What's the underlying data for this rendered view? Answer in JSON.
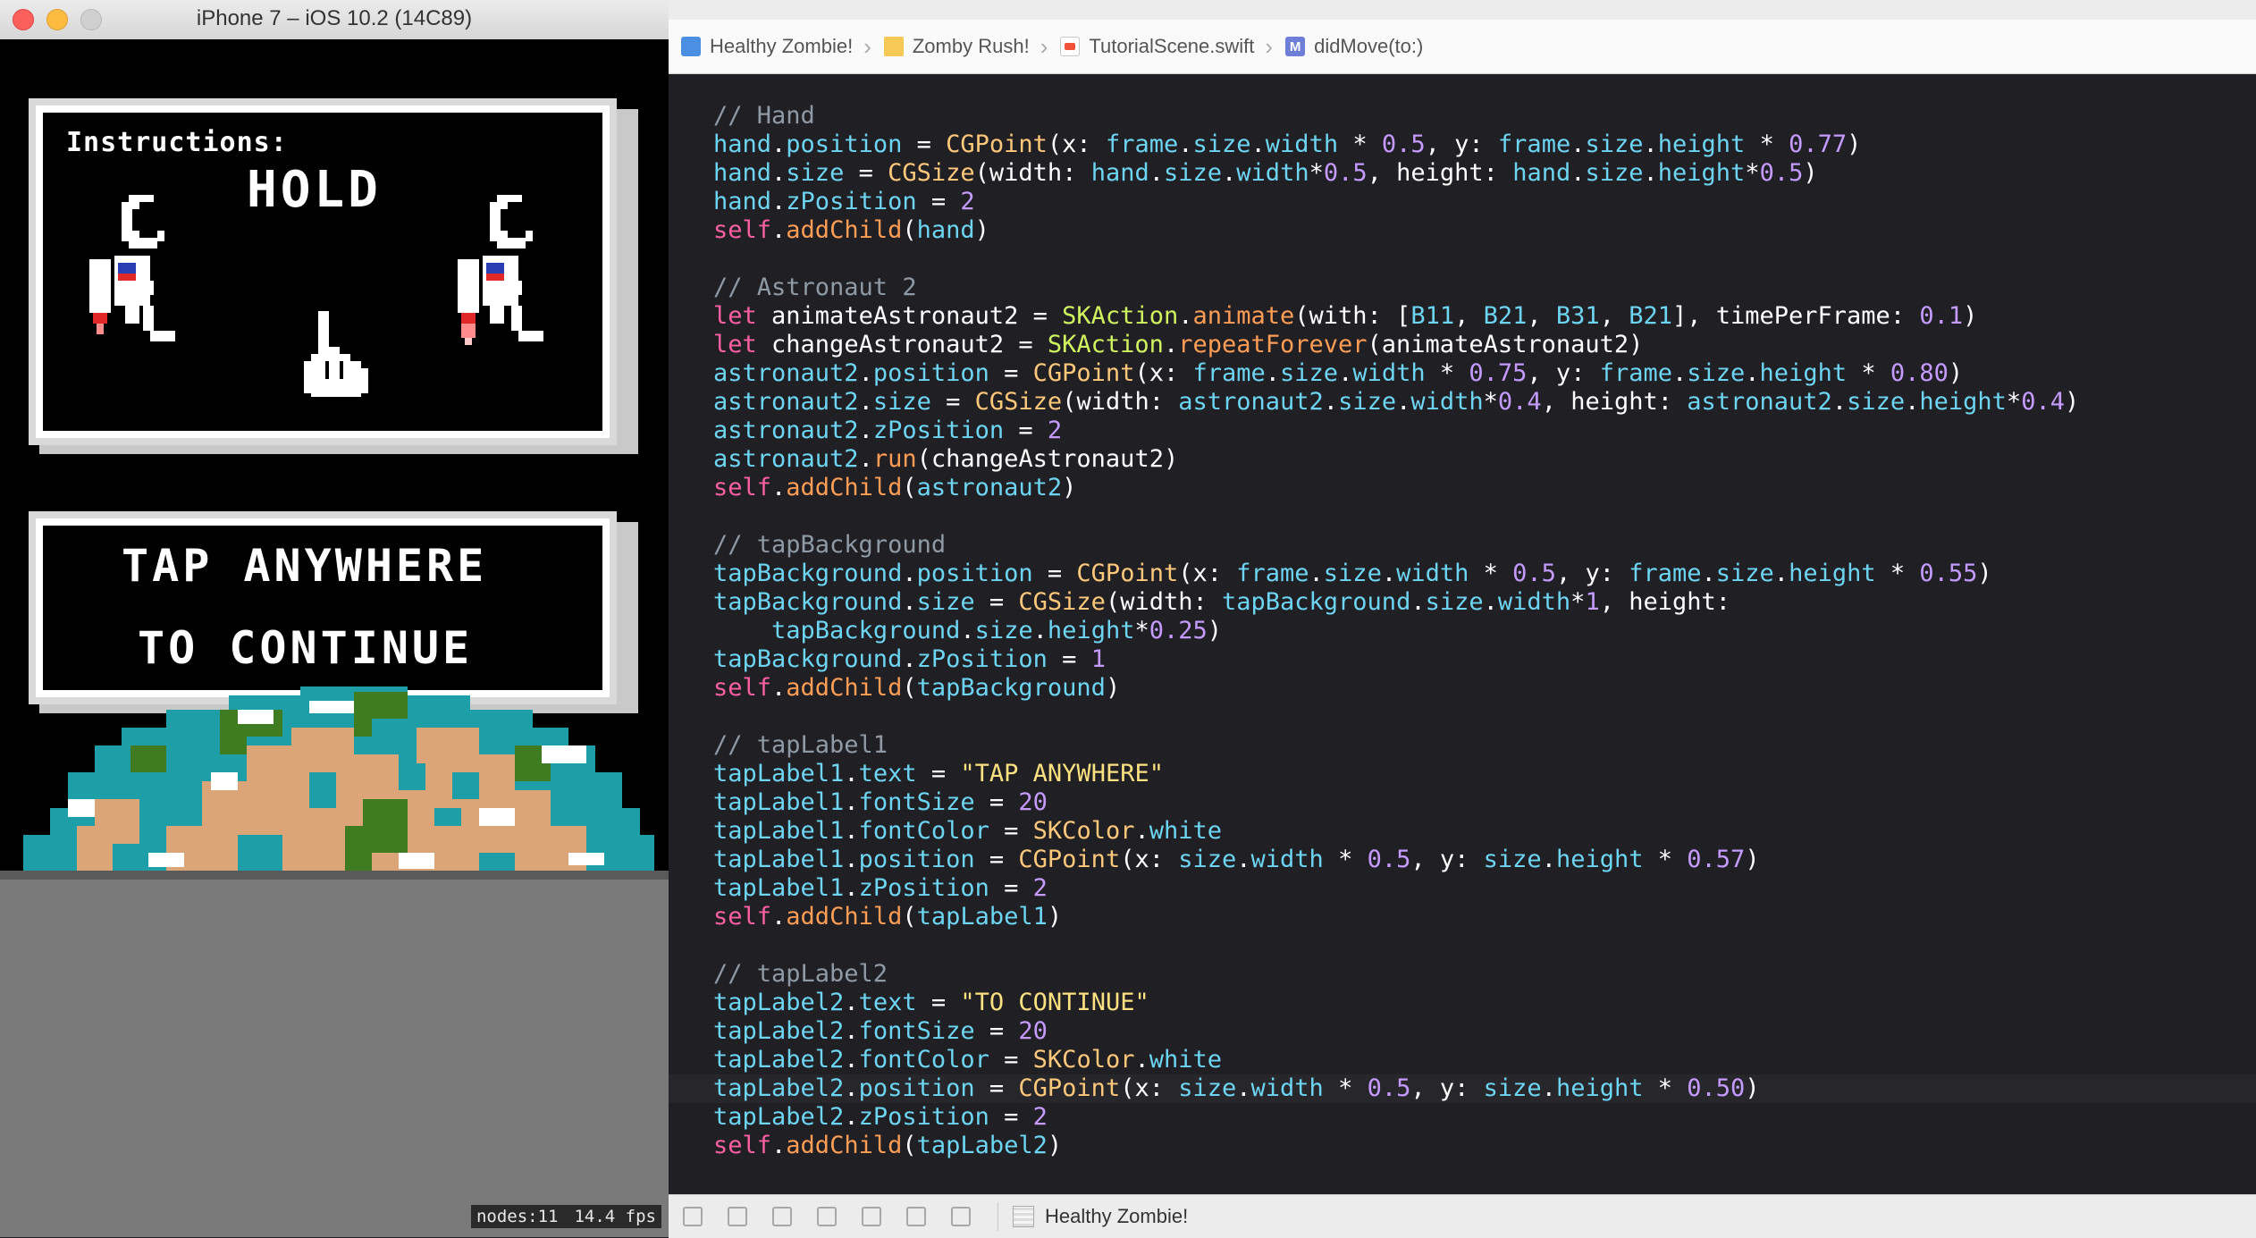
{
  "simulator": {
    "title": "iPhone 7 – iOS 10.2 (14C89)",
    "game": {
      "instructions_label": "Instructions:",
      "hold_label": "HOLD",
      "tap_line1": "TAP ANYWHERE",
      "tap_line2": "TO CONTINUE"
    },
    "stats": {
      "nodes": "nodes:11",
      "fps": "14.4 fps"
    }
  },
  "xcode": {
    "breadcrumb": [
      {
        "label": "Healthy Zombie!",
        "icon": "app-project-icon"
      },
      {
        "label": "Zomby Rush!",
        "icon": "folder-icon"
      },
      {
        "label": "TutorialScene.swift",
        "icon": "swift-file-icon"
      },
      {
        "label": "didMove(to:)",
        "icon": "method-icon"
      }
    ],
    "method_badge": "M",
    "debug_target": "Healthy Zombie!",
    "highlighted_line_index": 34,
    "code_lines": [
      [
        [
          "comment",
          "// Hand"
        ]
      ],
      [
        [
          "prop",
          "hand"
        ],
        [
          "plain",
          "."
        ],
        [
          "prop",
          "position"
        ],
        [
          "plain",
          " = "
        ],
        [
          "type",
          "CGPoint"
        ],
        [
          "plain",
          "(x: "
        ],
        [
          "prop",
          "frame"
        ],
        [
          "plain",
          "."
        ],
        [
          "prop",
          "size"
        ],
        [
          "plain",
          "."
        ],
        [
          "prop",
          "width"
        ],
        [
          "plain",
          " * "
        ],
        [
          "num",
          "0.5"
        ],
        [
          "plain",
          ", y: "
        ],
        [
          "prop",
          "frame"
        ],
        [
          "plain",
          "."
        ],
        [
          "prop",
          "size"
        ],
        [
          "plain",
          "."
        ],
        [
          "prop",
          "height"
        ],
        [
          "plain",
          " * "
        ],
        [
          "num",
          "0.77"
        ],
        [
          "plain",
          ")"
        ]
      ],
      [
        [
          "prop",
          "hand"
        ],
        [
          "plain",
          "."
        ],
        [
          "prop",
          "size"
        ],
        [
          "plain",
          " = "
        ],
        [
          "type",
          "CGSize"
        ],
        [
          "plain",
          "(width: "
        ],
        [
          "prop",
          "hand"
        ],
        [
          "plain",
          "."
        ],
        [
          "prop",
          "size"
        ],
        [
          "plain",
          "."
        ],
        [
          "prop",
          "width"
        ],
        [
          "plain",
          "*"
        ],
        [
          "num",
          "0.5"
        ],
        [
          "plain",
          ", height: "
        ],
        [
          "prop",
          "hand"
        ],
        [
          "plain",
          "."
        ],
        [
          "prop",
          "size"
        ],
        [
          "plain",
          "."
        ],
        [
          "prop",
          "height"
        ],
        [
          "plain",
          "*"
        ],
        [
          "num",
          "0.5"
        ],
        [
          "plain",
          ")"
        ]
      ],
      [
        [
          "prop",
          "hand"
        ],
        [
          "plain",
          "."
        ],
        [
          "prop",
          "zPosition"
        ],
        [
          "plain",
          " = "
        ],
        [
          "num",
          "2"
        ]
      ],
      [
        [
          "kw",
          "self"
        ],
        [
          "plain",
          "."
        ],
        [
          "func",
          "addChild"
        ],
        [
          "plain",
          "("
        ],
        [
          "prop",
          "hand"
        ],
        [
          "plain",
          ")"
        ]
      ],
      [],
      [
        [
          "comment",
          "// Astronaut 2"
        ]
      ],
      [
        [
          "kw",
          "let"
        ],
        [
          "plain",
          " animateAstronaut2 = "
        ],
        [
          "sk",
          "SKAction"
        ],
        [
          "plain",
          "."
        ],
        [
          "func",
          "animate"
        ],
        [
          "plain",
          "(with: ["
        ],
        [
          "prop",
          "B11"
        ],
        [
          "plain",
          ", "
        ],
        [
          "prop",
          "B21"
        ],
        [
          "plain",
          ", "
        ],
        [
          "prop",
          "B31"
        ],
        [
          "plain",
          ", "
        ],
        [
          "prop",
          "B21"
        ],
        [
          "plain",
          "], timePerFrame: "
        ],
        [
          "num",
          "0.1"
        ],
        [
          "plain",
          ")"
        ]
      ],
      [
        [
          "kw",
          "let"
        ],
        [
          "plain",
          " changeAstronaut2 = "
        ],
        [
          "sk",
          "SKAction"
        ],
        [
          "plain",
          "."
        ],
        [
          "func",
          "repeatForever"
        ],
        [
          "plain",
          "(animateAstronaut2)"
        ]
      ],
      [
        [
          "prop",
          "astronaut2"
        ],
        [
          "plain",
          "."
        ],
        [
          "prop",
          "position"
        ],
        [
          "plain",
          " = "
        ],
        [
          "type",
          "CGPoint"
        ],
        [
          "plain",
          "(x: "
        ],
        [
          "prop",
          "frame"
        ],
        [
          "plain",
          "."
        ],
        [
          "prop",
          "size"
        ],
        [
          "plain",
          "."
        ],
        [
          "prop",
          "width"
        ],
        [
          "plain",
          " * "
        ],
        [
          "num",
          "0.75"
        ],
        [
          "plain",
          ", y: "
        ],
        [
          "prop",
          "frame"
        ],
        [
          "plain",
          "."
        ],
        [
          "prop",
          "size"
        ],
        [
          "plain",
          "."
        ],
        [
          "prop",
          "height"
        ],
        [
          "plain",
          " * "
        ],
        [
          "num",
          "0.80"
        ],
        [
          "plain",
          ")"
        ]
      ],
      [
        [
          "prop",
          "astronaut2"
        ],
        [
          "plain",
          "."
        ],
        [
          "prop",
          "size"
        ],
        [
          "plain",
          " = "
        ],
        [
          "type",
          "CGSize"
        ],
        [
          "plain",
          "(width: "
        ],
        [
          "prop",
          "astronaut2"
        ],
        [
          "plain",
          "."
        ],
        [
          "prop",
          "size"
        ],
        [
          "plain",
          "."
        ],
        [
          "prop",
          "width"
        ],
        [
          "plain",
          "*"
        ],
        [
          "num",
          "0.4"
        ],
        [
          "plain",
          ", height: "
        ],
        [
          "prop",
          "astronaut2"
        ],
        [
          "plain",
          "."
        ],
        [
          "prop",
          "size"
        ],
        [
          "plain",
          "."
        ],
        [
          "prop",
          "height"
        ],
        [
          "plain",
          "*"
        ],
        [
          "num",
          "0.4"
        ],
        [
          "plain",
          ")"
        ]
      ],
      [
        [
          "prop",
          "astronaut2"
        ],
        [
          "plain",
          "."
        ],
        [
          "prop",
          "zPosition"
        ],
        [
          "plain",
          " = "
        ],
        [
          "num",
          "2"
        ]
      ],
      [
        [
          "prop",
          "astronaut2"
        ],
        [
          "plain",
          "."
        ],
        [
          "func",
          "run"
        ],
        [
          "plain",
          "(changeAstronaut2)"
        ]
      ],
      [
        [
          "kw",
          "self"
        ],
        [
          "plain",
          "."
        ],
        [
          "func",
          "addChild"
        ],
        [
          "plain",
          "("
        ],
        [
          "prop",
          "astronaut2"
        ],
        [
          "plain",
          ")"
        ]
      ],
      [],
      [
        [
          "comment",
          "// tapBackground"
        ]
      ],
      [
        [
          "prop",
          "tapBackground"
        ],
        [
          "plain",
          "."
        ],
        [
          "prop",
          "position"
        ],
        [
          "plain",
          " = "
        ],
        [
          "type",
          "CGPoint"
        ],
        [
          "plain",
          "(x: "
        ],
        [
          "prop",
          "frame"
        ],
        [
          "plain",
          "."
        ],
        [
          "prop",
          "size"
        ],
        [
          "plain",
          "."
        ],
        [
          "prop",
          "width"
        ],
        [
          "plain",
          " * "
        ],
        [
          "num",
          "0.5"
        ],
        [
          "plain",
          ", y: "
        ],
        [
          "prop",
          "frame"
        ],
        [
          "plain",
          "."
        ],
        [
          "prop",
          "size"
        ],
        [
          "plain",
          "."
        ],
        [
          "prop",
          "height"
        ],
        [
          "plain",
          " * "
        ],
        [
          "num",
          "0.55"
        ],
        [
          "plain",
          ")"
        ]
      ],
      [
        [
          "prop",
          "tapBackground"
        ],
        [
          "plain",
          "."
        ],
        [
          "prop",
          "size"
        ],
        [
          "plain",
          " = "
        ],
        [
          "type",
          "CGSize"
        ],
        [
          "plain",
          "(width: "
        ],
        [
          "prop",
          "tapBackground"
        ],
        [
          "plain",
          "."
        ],
        [
          "prop",
          "size"
        ],
        [
          "plain",
          "."
        ],
        [
          "prop",
          "width"
        ],
        [
          "plain",
          "*"
        ],
        [
          "num",
          "1"
        ],
        [
          "plain",
          ", height:"
        ]
      ],
      [
        [
          "plain",
          "    "
        ],
        [
          "prop",
          "tapBackground"
        ],
        [
          "plain",
          "."
        ],
        [
          "prop",
          "size"
        ],
        [
          "plain",
          "."
        ],
        [
          "prop",
          "height"
        ],
        [
          "plain",
          "*"
        ],
        [
          "num",
          "0.25"
        ],
        [
          "plain",
          ")"
        ]
      ],
      [
        [
          "prop",
          "tapBackground"
        ],
        [
          "plain",
          "."
        ],
        [
          "prop",
          "zPosition"
        ],
        [
          "plain",
          " = "
        ],
        [
          "num",
          "1"
        ]
      ],
      [
        [
          "kw",
          "self"
        ],
        [
          "plain",
          "."
        ],
        [
          "func",
          "addChild"
        ],
        [
          "plain",
          "("
        ],
        [
          "prop",
          "tapBackground"
        ],
        [
          "plain",
          ")"
        ]
      ],
      [],
      [
        [
          "comment",
          "// tapLabel1"
        ]
      ],
      [
        [
          "prop",
          "tapLabel1"
        ],
        [
          "plain",
          "."
        ],
        [
          "prop",
          "text"
        ],
        [
          "plain",
          " = "
        ],
        [
          "str",
          "\"TAP ANYWHERE\""
        ]
      ],
      [
        [
          "prop",
          "tapLabel1"
        ],
        [
          "plain",
          "."
        ],
        [
          "prop",
          "fontSize"
        ],
        [
          "plain",
          " = "
        ],
        [
          "num",
          "20"
        ]
      ],
      [
        [
          "prop",
          "tapLabel1"
        ],
        [
          "plain",
          "."
        ],
        [
          "prop",
          "fontColor"
        ],
        [
          "plain",
          " = "
        ],
        [
          "type",
          "SKColor"
        ],
        [
          "plain",
          "."
        ],
        [
          "prop",
          "white"
        ]
      ],
      [
        [
          "prop",
          "tapLabel1"
        ],
        [
          "plain",
          "."
        ],
        [
          "prop",
          "position"
        ],
        [
          "plain",
          " = "
        ],
        [
          "type",
          "CGPoint"
        ],
        [
          "plain",
          "(x: "
        ],
        [
          "prop",
          "size"
        ],
        [
          "plain",
          "."
        ],
        [
          "prop",
          "width"
        ],
        [
          "plain",
          " * "
        ],
        [
          "num",
          "0.5"
        ],
        [
          "plain",
          ", y: "
        ],
        [
          "prop",
          "size"
        ],
        [
          "plain",
          "."
        ],
        [
          "prop",
          "height"
        ],
        [
          "plain",
          " * "
        ],
        [
          "num",
          "0.57"
        ],
        [
          "plain",
          ")"
        ]
      ],
      [
        [
          "prop",
          "tapLabel1"
        ],
        [
          "plain",
          "."
        ],
        [
          "prop",
          "zPosition"
        ],
        [
          "plain",
          " = "
        ],
        [
          "num",
          "2"
        ]
      ],
      [
        [
          "kw",
          "self"
        ],
        [
          "plain",
          "."
        ],
        [
          "func",
          "addChild"
        ],
        [
          "plain",
          "("
        ],
        [
          "prop",
          "tapLabel1"
        ],
        [
          "plain",
          ")"
        ]
      ],
      [],
      [
        [
          "comment",
          "// tapLabel2"
        ]
      ],
      [
        [
          "prop",
          "tapLabel2"
        ],
        [
          "plain",
          "."
        ],
        [
          "prop",
          "text"
        ],
        [
          "plain",
          " = "
        ],
        [
          "str",
          "\"TO CONTINUE\""
        ]
      ],
      [
        [
          "prop",
          "tapLabel2"
        ],
        [
          "plain",
          "."
        ],
        [
          "prop",
          "fontSize"
        ],
        [
          "plain",
          " = "
        ],
        [
          "num",
          "20"
        ]
      ],
      [
        [
          "prop",
          "tapLabel2"
        ],
        [
          "plain",
          "."
        ],
        [
          "prop",
          "fontColor"
        ],
        [
          "plain",
          " = "
        ],
        [
          "type",
          "SKColor"
        ],
        [
          "plain",
          "."
        ],
        [
          "prop",
          "white"
        ]
      ],
      [
        [
          "prop",
          "tapLabel2"
        ],
        [
          "plain",
          "."
        ],
        [
          "prop",
          "position"
        ],
        [
          "plain",
          " = "
        ],
        [
          "type",
          "CGPoint"
        ],
        [
          "plain",
          "(x: "
        ],
        [
          "prop",
          "size"
        ],
        [
          "plain",
          "."
        ],
        [
          "prop",
          "width"
        ],
        [
          "plain",
          " * "
        ],
        [
          "num",
          "0.5"
        ],
        [
          "plain",
          ", y: "
        ],
        [
          "prop",
          "size"
        ],
        [
          "plain",
          "."
        ],
        [
          "prop",
          "height"
        ],
        [
          "plain",
          " * "
        ],
        [
          "num",
          "0.50"
        ],
        [
          "plain",
          ")"
        ]
      ],
      [
        [
          "prop",
          "tapLabel2"
        ],
        [
          "plain",
          "."
        ],
        [
          "prop",
          "zPosition"
        ],
        [
          "plain",
          " = "
        ],
        [
          "num",
          "2"
        ]
      ],
      [
        [
          "kw",
          "self"
        ],
        [
          "plain",
          "."
        ],
        [
          "func",
          "addChild"
        ],
        [
          "plain",
          "("
        ],
        [
          "prop",
          "tapLabel2"
        ],
        [
          "plain",
          ")"
        ]
      ]
    ]
  },
  "colors": {
    "comment": "#8f9aa5",
    "property": "#6dd5f2",
    "type": "#fec87b",
    "spritekit_class": "#d1f35f",
    "function": "#ff9d55",
    "number": "#c59bff",
    "keyword": "#fc5fa3",
    "string": "#fce181",
    "editor_background": "#1f1f24"
  }
}
